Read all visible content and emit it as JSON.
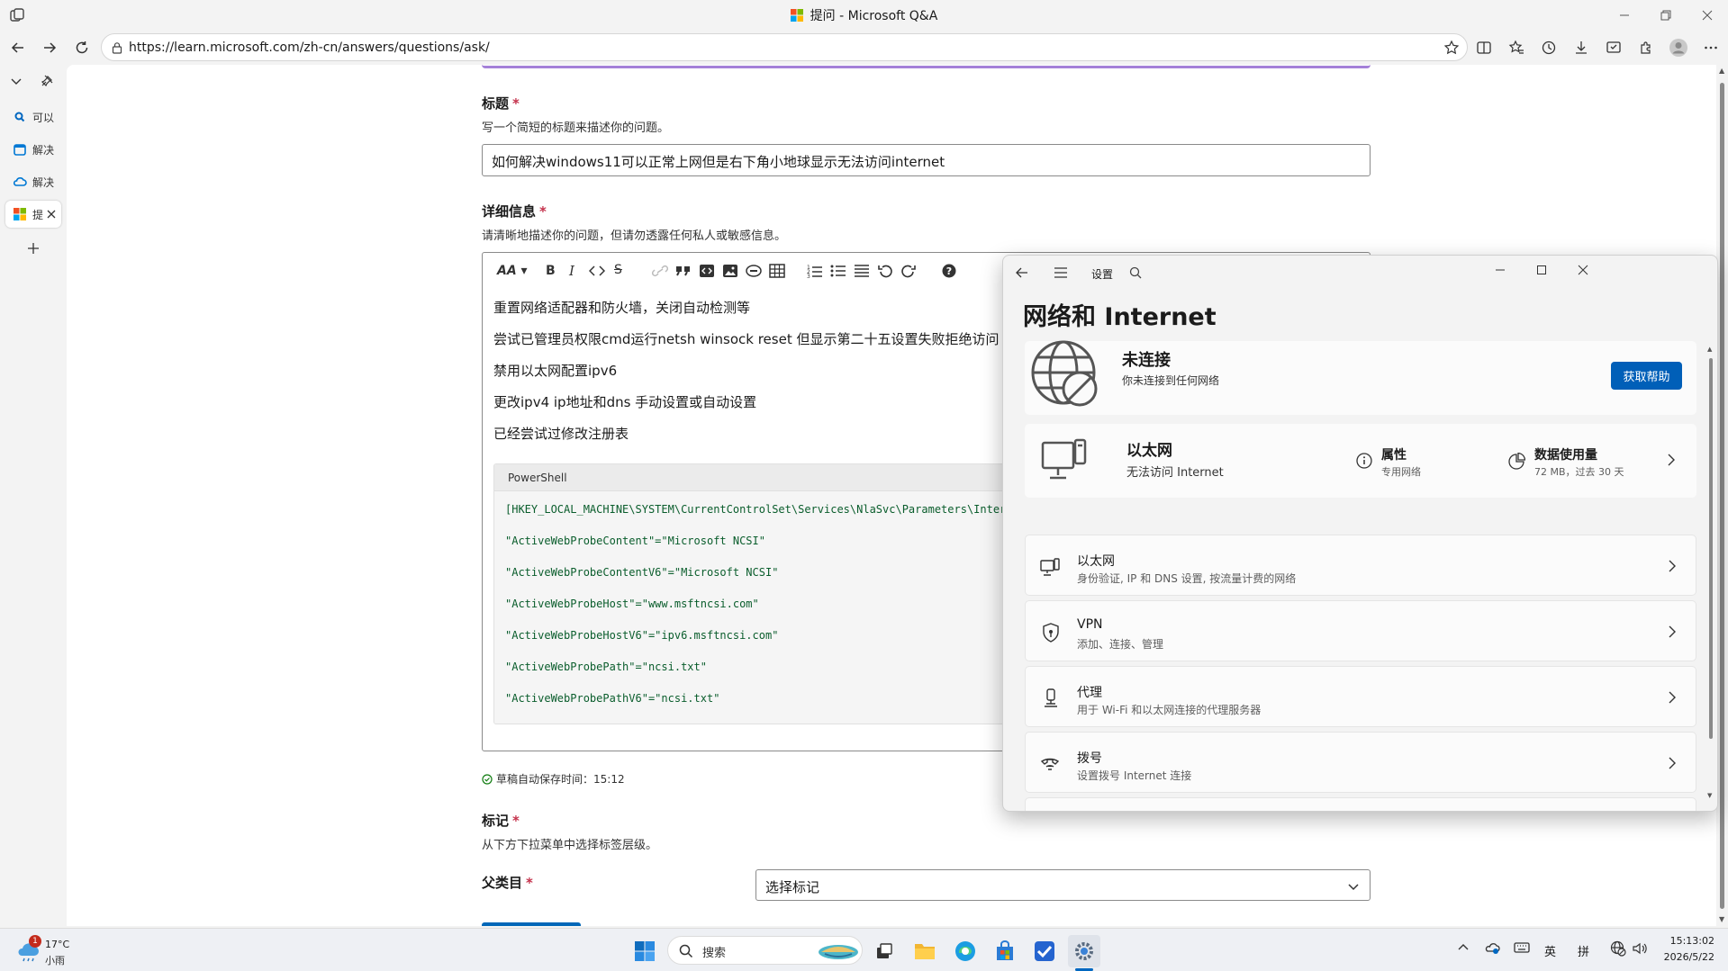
{
  "window": {
    "title": "提问 - Microsoft Q&A"
  },
  "browser": {
    "url": "https://learn.microsoft.com/zh-cn/answers/questions/ask/"
  },
  "tabs": [
    {
      "label": "可以"
    },
    {
      "label": "解决"
    },
    {
      "label": "解决"
    },
    {
      "label": "提"
    }
  ],
  "form": {
    "title_label": "标题",
    "title_help": "写一个简短的标题来描述你的问题。",
    "title_value": "如何解决windows11可以正常上网但是右下角小地球显示无法访问internet",
    "details_label": "详细信息",
    "details_help": "请清晰地描述你的问题，但请勿透露任何私人或敏感信息。",
    "editor_lines": [
      "重置网络适配器和防火墙，关闭自动检测等",
      "尝试已管理员权限cmd运行netsh winsock reset 但显示第二十五设置失败拒绝访问",
      "禁用以太网配置ipv6",
      "更改ipv4 ip地址和dns 手动设置或自动设置",
      "已经尝试过修改注册表"
    ],
    "code_lang": "PowerShell",
    "code_lines": [
      "[HKEY_LOCAL_MACHINE\\SYSTEM\\CurrentControlSet\\Services\\NlaSvc\\Parameters\\Internet]",
      "\"ActiveWebProbeContent\"=\"Microsoft NCSI\"",
      "\"ActiveWebProbeContentV6\"=\"Microsoft NCSI\"",
      "\"ActiveWebProbeHost\"=\"www.msftncsi.com\"",
      "\"ActiveWebProbeHostV6\"=\"ipv6.msftncsi.com\"",
      "\"ActiveWebProbePath\"=\"ncsi.txt\"",
      "\"ActiveWebProbePathV6\"=\"ncsi.txt\""
    ],
    "autosave": "草稿自动保存时间：15:12",
    "tags_label": "标记",
    "tags_help": "从下方下拉菜单中选择标签层级。",
    "parent_label": "父类目",
    "parent_placeholder": "选择标记"
  },
  "settings": {
    "app_name": "设置",
    "page_title": "网络和 Internet",
    "status_title": "未连接",
    "status_sub": "你未连接到任何网络",
    "help_button": "获取帮助",
    "ethernet": {
      "name": "以太网",
      "status": "无法访问 Internet",
      "props_title": "属性",
      "props_sub": "专用网络",
      "usage_title": "数据使用量",
      "usage_sub": "72 MB，过去 30 天"
    },
    "rows": [
      {
        "title": "以太网",
        "sub": "身份验证, IP 和 DNS 设置, 按流量计费的网络"
      },
      {
        "title": "VPN",
        "sub": "添加、连接、管理"
      },
      {
        "title": "代理",
        "sub": "用于 Wi-Fi 和以太网连接的代理服务器"
      },
      {
        "title": "拨号",
        "sub": "设置拨号 Internet 连接"
      }
    ]
  },
  "taskbar": {
    "weather_temp": "17°C",
    "weather_desc": "小雨",
    "weather_badge": "1",
    "search_label": "搜索",
    "ime_lang": "英",
    "ime_mode": "拼",
    "time": "15:13:02",
    "date": "2026/5/22"
  },
  "colors": {
    "accent": "#005fb8",
    "required": "#c4314b"
  }
}
